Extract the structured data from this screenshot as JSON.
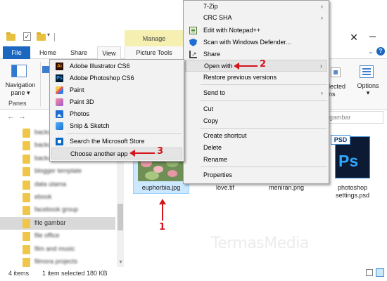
{
  "titlebar": {
    "manage_label": "Manage",
    "close_glyph": "✕"
  },
  "ribbon": {
    "tabs": [
      "File",
      "Home",
      "Share",
      "View",
      "Picture Tools"
    ],
    "navigation_pane_label": "Navigation pane ▾",
    "panes_label": "Panes",
    "selected_fragment": "lected\nns",
    "options_label": "Options",
    "options_arrow": "▾"
  },
  "address": {
    "search_placeholder_fragment": "gambar"
  },
  "nav": {
    "items": [
      {
        "label": "backup",
        "blurred": true
      },
      {
        "label": "backup2",
        "blurred": true
      },
      {
        "label": "backup3",
        "blurred": true
      },
      {
        "label": "blogger template",
        "blurred": true
      },
      {
        "label": "data utama",
        "blurred": true
      },
      {
        "label": "ebook",
        "blurred": true
      },
      {
        "label": "facebook group",
        "blurred": true
      },
      {
        "label": "file gambar",
        "blurred": false,
        "selected": true
      },
      {
        "label": "file office",
        "blurred": true
      },
      {
        "label": "film and music",
        "blurred": true
      },
      {
        "label": "filmora projects",
        "blurred": true
      }
    ]
  },
  "files": {
    "euphorbia": "euphorbia.jpg",
    "love": "love.tif",
    "meniran": "meniran.png",
    "photoshop": "photoshop\nsettings.psd",
    "psd_tab": "PSD",
    "ps_letters": "Ps"
  },
  "watermark": "TermasMedia",
  "status": {
    "count": "4 items",
    "selected": "1 item selected  180 KB"
  },
  "main_menu": {
    "items": {
      "zip": "7-Zip",
      "crc": "CRC SHA",
      "notepad": "Edit with Notepad++",
      "defender": "Scan with Windows Defender...",
      "share": "Share",
      "open_with": "Open with",
      "restore": "Restore previous versions",
      "send_to": "Send to",
      "cut": "Cut",
      "copy": "Copy",
      "shortcut": "Create shortcut",
      "delete": "Delete",
      "rename": "Rename",
      "properties": "Properties"
    },
    "submenu_arrow": "›"
  },
  "openwith_menu": {
    "items": {
      "illustrator": "Adobe Illustrator CS6",
      "photoshop": "Adobe Photoshop CS6",
      "paint": "Paint",
      "paint3d": "Paint 3D",
      "photos": "Photos",
      "snip": "Snip & Sketch",
      "store": "Search the Microsoft Store",
      "choose": "Choose another app"
    },
    "icon_ai": "Ai",
    "icon_ps": "Ps"
  },
  "callouts": {
    "one": "1",
    "two": "2",
    "three": "3"
  },
  "colors": {
    "accent": "#1c68c0",
    "manage_band": "#f5f0b2",
    "callout_red": "#d4151b",
    "selection_blue": "#cce8ff"
  }
}
